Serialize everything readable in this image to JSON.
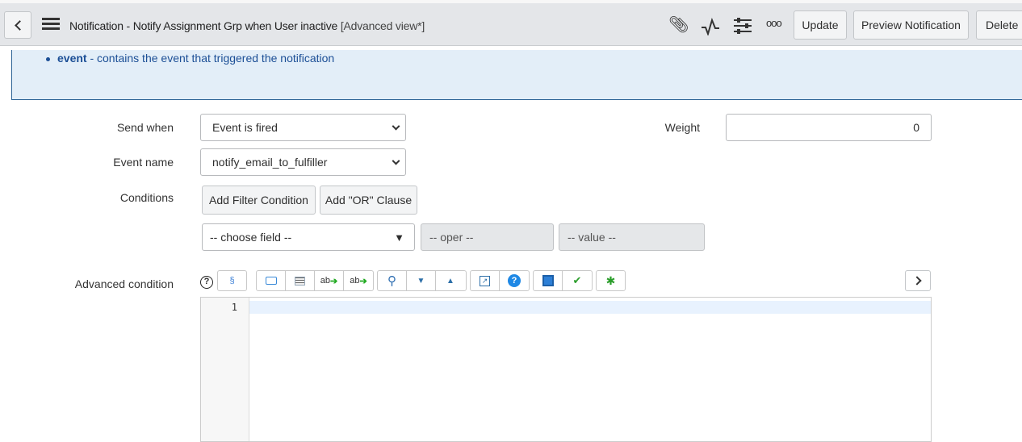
{
  "header": {
    "title": "Notification - Notify Assignment Grp when User inactive",
    "view": "[Advanced view*]",
    "buttons": {
      "update": "Update",
      "preview": "Preview Notification",
      "delete": "Delete"
    }
  },
  "info": {
    "term": "event",
    "desc": " - contains the event that triggered the notification"
  },
  "form": {
    "send_when": {
      "label": "Send when",
      "value": "Event is fired"
    },
    "weight": {
      "label": "Weight",
      "value": "0"
    },
    "event_name": {
      "label": "Event name",
      "value": "notify_email_to_fulfiller"
    },
    "conditions": {
      "label": "Conditions",
      "add_filter": "Add Filter Condition",
      "add_or": "Add \"OR\" Clause",
      "field": "-- choose field --",
      "oper": "-- oper --",
      "value": "-- value --"
    },
    "advanced": {
      "label": "Advanced condition",
      "help": "?",
      "line": "1"
    }
  }
}
